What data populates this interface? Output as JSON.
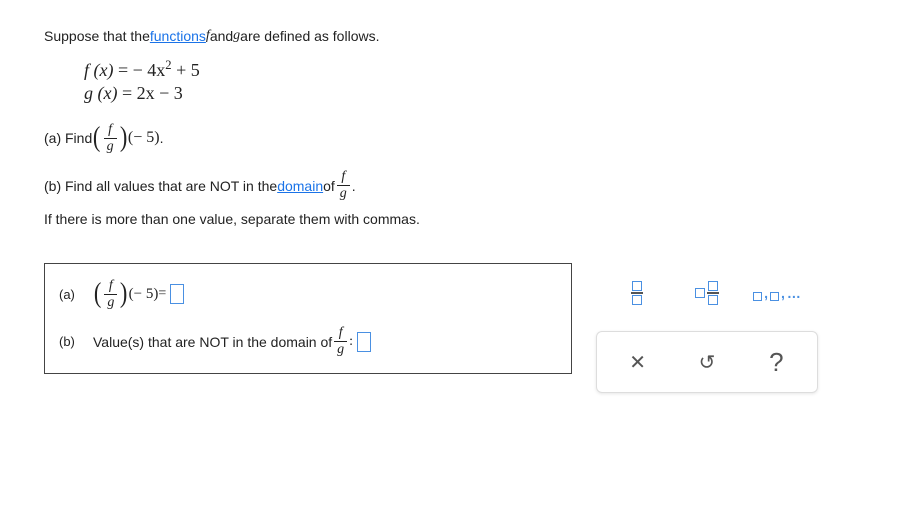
{
  "intro": {
    "pre": "Suppose that the ",
    "link": "functions",
    "mid": " ",
    "fvar": "f",
    "and": " and ",
    "gvar": "g",
    "post": " are defined as follows."
  },
  "equations": {
    "f_lhs": "f (x)",
    "f_rhs": " = − 4x",
    "f_exp": "2",
    "f_tail": " + 5",
    "g_lhs": "g (x)",
    "g_rhs": " = 2x − 3"
  },
  "partA": {
    "label": "(a) Find ",
    "arg": "(− 5)",
    "period": "."
  },
  "partB": {
    "line1_pre": "(b) Find all values that are NOT in the ",
    "line1_link": "domain",
    "line1_post": " of ",
    "line1_period": ".",
    "line2": "If there is more than one value, separate them with commas."
  },
  "frac": {
    "num": "f",
    "den": "g"
  },
  "answers": {
    "a_label": "(a)",
    "a_arg": "(− 5)",
    "a_eq": " = ",
    "b_label": "(b)",
    "b_text_pre": "Value(s) that are NOT in the domain of ",
    "b_colon": " :"
  },
  "tools": {
    "clear": "✕",
    "reset": "↺",
    "help": "?",
    "list_sep1": ",",
    "list_sep2": ",",
    "list_tail": "…"
  }
}
